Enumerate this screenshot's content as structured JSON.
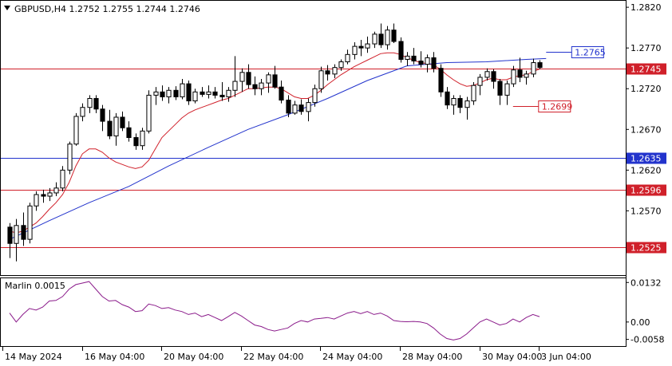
{
  "window": {
    "symbol_line": "GBPUSD,H4  1.2752 1.2755 1.2744 1.2746",
    "indicator_label": "Marlin 0.0015"
  },
  "colors": {
    "bull_fill": "#ffffff",
    "bear_fill": "#000000",
    "candle_outline": "#000000",
    "ma_fast": "#d0202a",
    "ma_slow": "#2233cc",
    "level_red": "#d0202a",
    "level_blue": "#2233cc",
    "oscillator": "#8a1a8a",
    "grid_border": "#000000"
  },
  "chart_data": [
    {
      "type": "candlestick",
      "title": "GBPUSD,H4  1.2752 1.2755 1.2744 1.2746",
      "ylim": [
        1.2495,
        1.2825
      ],
      "y_ticks": [
        "1.2820",
        "1.2770",
        "1.2720",
        "1.2670",
        "1.2620",
        "1.2570"
      ],
      "x_tick_labels": [
        "14 May 2024",
        "16 May 04:00",
        "20 May 04:00",
        "22 May 04:00",
        "24 May 04:00",
        "28 May 04:00",
        "30 May 04:00",
        "3 Jun 04:00"
      ],
      "candles": [
        [
          1.255,
          1.2555,
          1.2512,
          1.253
        ],
        [
          1.253,
          1.256,
          1.2508,
          1.2552
        ],
        [
          1.2552,
          1.2568,
          1.2527,
          1.2535
        ],
        [
          1.2535,
          1.258,
          1.253,
          1.2576
        ],
        [
          1.2576,
          1.2594,
          1.257,
          1.259
        ],
        [
          1.259,
          1.2596,
          1.258,
          1.2588
        ],
        [
          1.2588,
          1.2598,
          1.2582,
          1.2592
        ],
        [
          1.2592,
          1.2605,
          1.2588,
          1.2598
        ],
        [
          1.2598,
          1.2625,
          1.2594,
          1.262
        ],
        [
          1.262,
          1.2655,
          1.2615,
          1.2652
        ],
        [
          1.2652,
          1.269,
          1.265,
          1.2686
        ],
        [
          1.2686,
          1.2702,
          1.268,
          1.2697
        ],
        [
          1.2697,
          1.2712,
          1.269,
          1.2708
        ],
        [
          1.2708,
          1.2712,
          1.269,
          1.2695
        ],
        [
          1.2695,
          1.27,
          1.2668,
          1.268
        ],
        [
          1.268,
          1.2694,
          1.2658,
          1.2662
        ],
        [
          1.2662,
          1.269,
          1.265,
          1.2685
        ],
        [
          1.2685,
          1.2692,
          1.2668,
          1.2672
        ],
        [
          1.2672,
          1.268,
          1.2655,
          1.266
        ],
        [
          1.266,
          1.2665,
          1.2645,
          1.265
        ],
        [
          1.265,
          1.2672,
          1.2645,
          1.2668
        ],
        [
          1.2668,
          1.2718,
          1.2665,
          1.2712
        ],
        [
          1.2712,
          1.2722,
          1.27,
          1.2716
        ],
        [
          1.2716,
          1.2724,
          1.2705,
          1.271
        ],
        [
          1.271,
          1.2722,
          1.2702,
          1.2718
        ],
        [
          1.2718,
          1.2723,
          1.2706,
          1.271
        ],
        [
          1.271,
          1.2732,
          1.2707,
          1.2726
        ],
        [
          1.2726,
          1.273,
          1.27,
          1.2705
        ],
        [
          1.2705,
          1.272,
          1.2702,
          1.2716
        ],
        [
          1.2716,
          1.2722,
          1.271,
          1.2713
        ],
        [
          1.2713,
          1.2724,
          1.2708,
          1.2716
        ],
        [
          1.2716,
          1.2722,
          1.2708,
          1.2712
        ],
        [
          1.2712,
          1.2728,
          1.2705,
          1.271
        ],
        [
          1.271,
          1.2722,
          1.2704,
          1.2718
        ],
        [
          1.2718,
          1.276,
          1.271,
          1.2729
        ],
        [
          1.2729,
          1.2745,
          1.2716,
          1.274
        ],
        [
          1.274,
          1.275,
          1.272,
          1.2725
        ],
        [
          1.2725,
          1.2735,
          1.2712,
          1.272
        ],
        [
          1.272,
          1.2732,
          1.2712,
          1.2727
        ],
        [
          1.2727,
          1.274,
          1.2715,
          1.2737
        ],
        [
          1.2737,
          1.2748,
          1.272,
          1.2722
        ],
        [
          1.2722,
          1.273,
          1.2702,
          1.2706
        ],
        [
          1.2706,
          1.2712,
          1.2685,
          1.269
        ],
        [
          1.269,
          1.2705,
          1.2688,
          1.27
        ],
        [
          1.27,
          1.2707,
          1.2688,
          1.2692
        ],
        [
          1.2692,
          1.2708,
          1.268,
          1.2703
        ],
        [
          1.2703,
          1.2725,
          1.2698,
          1.272
        ],
        [
          1.272,
          1.2747,
          1.2715,
          1.2742
        ],
        [
          1.2742,
          1.2749,
          1.273,
          1.2738
        ],
        [
          1.2738,
          1.275,
          1.2733,
          1.2746
        ],
        [
          1.2746,
          1.2756,
          1.2742,
          1.2753
        ],
        [
          1.2753,
          1.2768,
          1.275,
          1.2762
        ],
        [
          1.2762,
          1.2777,
          1.2756,
          1.2772
        ],
        [
          1.2772,
          1.278,
          1.276,
          1.277
        ],
        [
          1.277,
          1.2784,
          1.2764,
          1.2775
        ],
        [
          1.2775,
          1.279,
          1.277,
          1.2787
        ],
        [
          1.2787,
          1.28,
          1.277,
          1.2774
        ],
        [
          1.2774,
          1.2797,
          1.2768,
          1.2792
        ],
        [
          1.2792,
          1.28,
          1.2776,
          1.2778
        ],
        [
          1.2778,
          1.2783,
          1.2752,
          1.2756
        ],
        [
          1.2756,
          1.2765,
          1.2748,
          1.276
        ],
        [
          1.276,
          1.277,
          1.275,
          1.2754
        ],
        [
          1.2754,
          1.2766,
          1.2746,
          1.275
        ],
        [
          1.275,
          1.2762,
          1.274,
          1.2758
        ],
        [
          1.2758,
          1.2765,
          1.274,
          1.2745
        ],
        [
          1.2745,
          1.275,
          1.271,
          1.2716
        ],
        [
          1.2716,
          1.2722,
          1.2695,
          1.27
        ],
        [
          1.27,
          1.2712,
          1.2688,
          1.2708
        ],
        [
          1.2708,
          1.2712,
          1.269,
          1.2697
        ],
        [
          1.2697,
          1.271,
          1.2682,
          1.2705
        ],
        [
          1.2705,
          1.2728,
          1.27,
          1.2724
        ],
        [
          1.2724,
          1.2738,
          1.2712,
          1.2734
        ],
        [
          1.2734,
          1.2745,
          1.273,
          1.2741
        ],
        [
          1.2741,
          1.2744,
          1.272,
          1.2729
        ],
        [
          1.2729,
          1.2732,
          1.27,
          1.2712
        ],
        [
          1.2712,
          1.273,
          1.27,
          1.2726
        ],
        [
          1.2726,
          1.2748,
          1.2722,
          1.2743
        ],
        [
          1.2743,
          1.2758,
          1.2728,
          1.2734
        ],
        [
          1.2734,
          1.2742,
          1.2725,
          1.2738
        ],
        [
          1.2738,
          1.2757,
          1.2734,
          1.2752
        ],
        [
          1.2752,
          1.2755,
          1.2744,
          1.2746
        ]
      ],
      "ma_fast": [
        1.2545,
        1.2543,
        1.2545,
        1.255,
        1.2555,
        1.2563,
        1.2572,
        1.258,
        1.259,
        1.2605,
        1.2625,
        1.264,
        1.2646,
        1.2646,
        1.2642,
        1.2635,
        1.263,
        1.2627,
        1.2624,
        1.2622,
        1.2624,
        1.2632,
        1.2646,
        1.266,
        1.2668,
        1.2676,
        1.2684,
        1.269,
        1.2694,
        1.2697,
        1.27,
        1.2703,
        1.2706,
        1.2708,
        1.2712,
        1.2716,
        1.272,
        1.272,
        1.2721,
        1.2722,
        1.2722,
        1.272,
        1.2715,
        1.271,
        1.2708,
        1.2708,
        1.2712,
        1.2718,
        1.2725,
        1.2731,
        1.2737,
        1.2742,
        1.2747,
        1.2751,
        1.2755,
        1.2759,
        1.2763,
        1.2764,
        1.2764,
        1.2762,
        1.2758,
        1.2755,
        1.2752,
        1.2751,
        1.2749,
        1.2744,
        1.2737,
        1.2731,
        1.2726,
        1.2723,
        1.2724,
        1.2727,
        1.2731,
        1.2733,
        1.2731,
        1.2731,
        1.2734,
        1.2736,
        1.2737,
        1.2741,
        1.2744
      ],
      "ma_slow_points": [
        [
          0,
          1.2535
        ],
        [
          6,
          1.2558
        ],
        [
          12,
          1.258
        ],
        [
          18,
          1.26
        ],
        [
          24,
          1.2625
        ],
        [
          30,
          1.2648
        ],
        [
          36,
          1.267
        ],
        [
          42,
          1.2688
        ],
        [
          48,
          1.2708
        ],
        [
          54,
          1.273
        ],
        [
          60,
          1.2748
        ],
        [
          66,
          1.2752
        ],
        [
          72,
          1.2753
        ],
        [
          78,
          1.2756
        ],
        [
          81,
          1.2757
        ]
      ],
      "levels": [
        {
          "label": "1.2745",
          "value": 1.2745,
          "color": "red",
          "style": "solid"
        },
        {
          "label": "1.2635",
          "value": 1.2635,
          "color": "blue",
          "style": "solid"
        },
        {
          "label": "1.2596",
          "value": 1.2596,
          "color": "red",
          "style": "solid"
        },
        {
          "label": "1.2525",
          "value": 1.2525,
          "color": "red",
          "style": "solid"
        }
      ],
      "annotations": [
        {
          "label": "1.2765",
          "value": 1.2765,
          "color": "blue",
          "start_index": 81
        },
        {
          "label": "1.2699",
          "value": 1.2699,
          "color": "red",
          "start_index": 76
        }
      ]
    },
    {
      "type": "line",
      "title": "Marlin 0.0015",
      "ylim": [
        -0.0075,
        0.0138
      ],
      "y_ticks": [
        "0.0132",
        "0.00",
        "-0.0058"
      ],
      "values": [
        0.003,
        0.0,
        0.0025,
        0.0045,
        0.004,
        0.005,
        0.007,
        0.0072,
        0.0085,
        0.011,
        0.0125,
        0.013,
        0.0135,
        0.011,
        0.0085,
        0.007,
        0.0072,
        0.0058,
        0.005,
        0.0035,
        0.0038,
        0.006,
        0.0055,
        0.0045,
        0.0048,
        0.004,
        0.0035,
        0.0025,
        0.003,
        0.0018,
        0.0025,
        0.0015,
        0.0005,
        0.0018,
        0.0032,
        0.002,
        0.0005,
        -0.001,
        -0.0015,
        -0.0025,
        -0.003,
        -0.0025,
        -0.002,
        -0.0005,
        0.0005,
        0.0,
        0.001,
        0.0012,
        0.0015,
        0.001,
        0.002,
        0.003,
        0.0035,
        0.0028,
        0.0035,
        0.0025,
        0.003,
        0.002,
        0.0005,
        0.0002,
        0.0001,
        0.0002,
        0.0,
        -0.0005,
        -0.002,
        -0.004,
        -0.0055,
        -0.006,
        -0.0055,
        -0.004,
        -0.002,
        0.0,
        0.001,
        0.0,
        -0.001,
        -0.0005,
        0.001,
        0.0,
        0.0015,
        0.0025,
        0.0018
      ]
    }
  ]
}
